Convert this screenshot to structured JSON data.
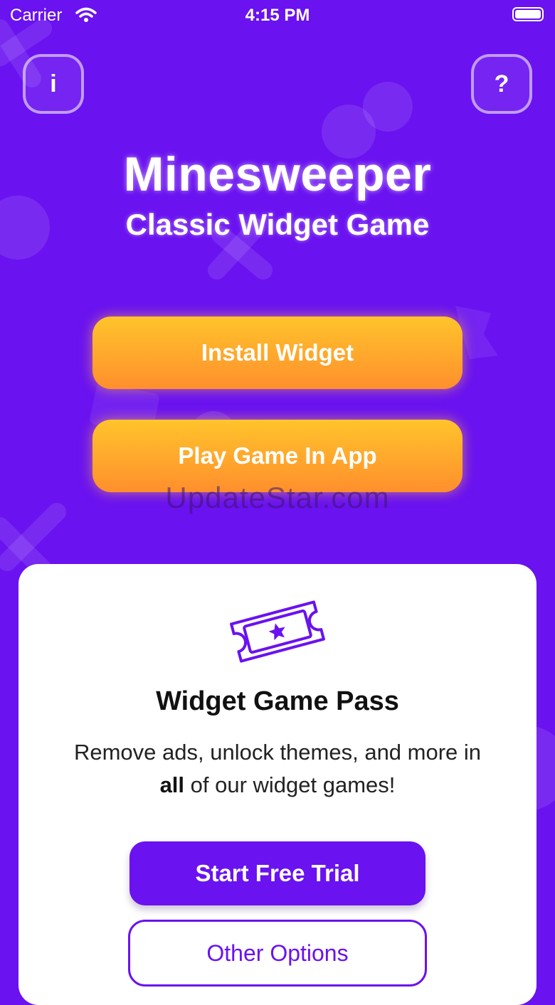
{
  "status_bar": {
    "carrier": "Carrier",
    "time": "4:15 PM"
  },
  "header": {
    "info_label": "i",
    "help_label": "?"
  },
  "hero": {
    "title": "Minesweeper",
    "subtitle": "Classic Widget Game"
  },
  "actions": {
    "install_label": "Install Widget",
    "play_label": "Play Game In App"
  },
  "watermark": "UpdateStar.com",
  "pass_card": {
    "title": "Widget Game Pass",
    "desc_line1": "Remove ads, unlock themes, and more in",
    "desc_bold": "all",
    "desc_rest": " of our widget games!",
    "trial_label": "Start Free Trial",
    "options_label": "Other Options"
  },
  "colors": {
    "background": "#6a12f0",
    "accent_orange": "#ff9b2e",
    "card": "#ffffff"
  },
  "icons": [
    "wifi-icon",
    "battery-icon",
    "ticket-star-icon"
  ]
}
